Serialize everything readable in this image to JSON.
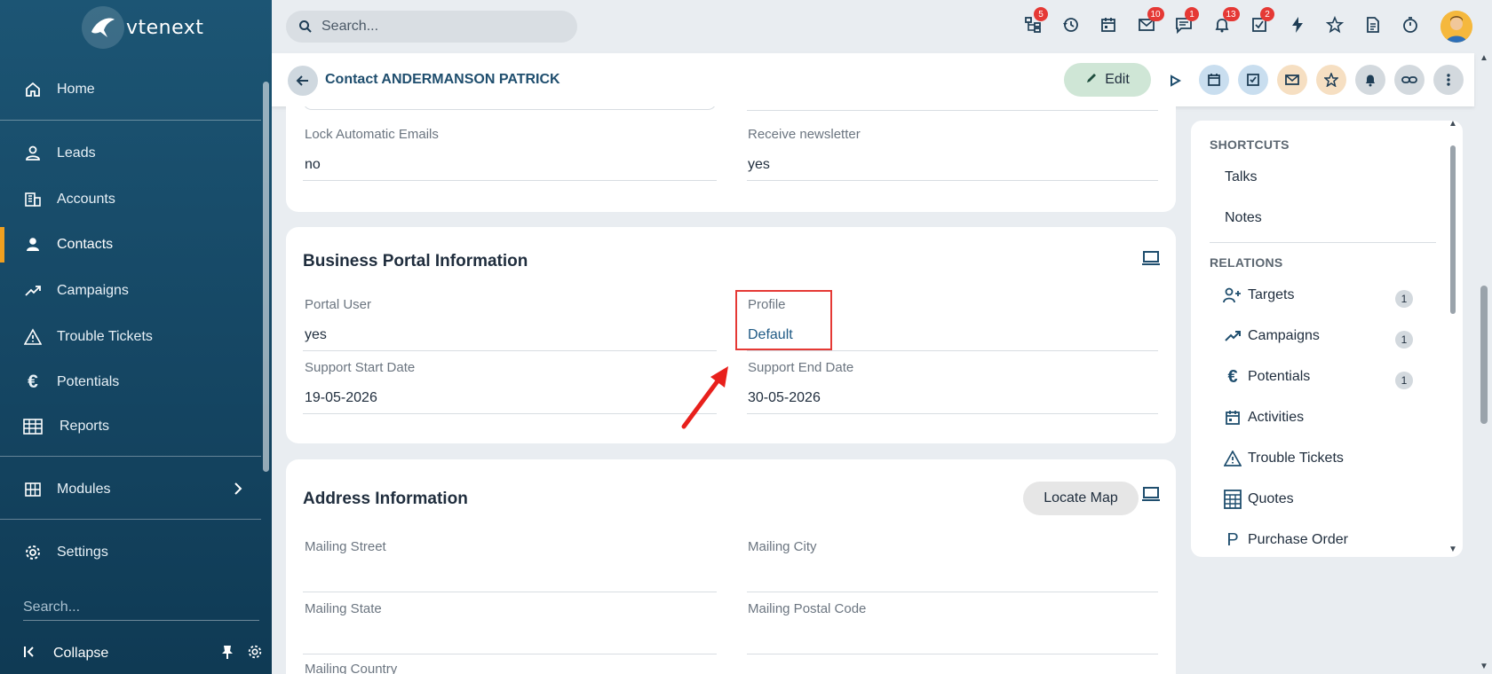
{
  "app": {
    "logo_text": "vtenext"
  },
  "sidebar": {
    "items": [
      {
        "label": "Home",
        "icon": "home-icon"
      },
      {
        "label": "Leads",
        "icon": "person-outline-icon"
      },
      {
        "label": "Accounts",
        "icon": "building-icon"
      },
      {
        "label": "Contacts",
        "icon": "person-icon"
      },
      {
        "label": "Campaigns",
        "icon": "trending-up-icon"
      },
      {
        "label": "Trouble Tickets",
        "icon": "warning-icon"
      },
      {
        "label": "Potentials",
        "icon": "euro-icon"
      },
      {
        "label": "Reports",
        "icon": "table-icon"
      },
      {
        "label": "Modules",
        "icon": "grid-icon"
      },
      {
        "label": "Settings",
        "icon": "gear-icon"
      }
    ],
    "active": "Contacts",
    "search_placeholder": "Search...",
    "collapse_label": "Collapse"
  },
  "topbar": {
    "search_placeholder": "Search...",
    "icons": [
      {
        "name": "hierarchy-icon",
        "badge": "5"
      },
      {
        "name": "history-icon",
        "badge": ""
      },
      {
        "name": "calendar-icon",
        "badge": ""
      },
      {
        "name": "mail-icon",
        "badge": "10"
      },
      {
        "name": "chat-icon",
        "badge": "1"
      },
      {
        "name": "bell-icon",
        "badge": "13"
      },
      {
        "name": "task-check-icon",
        "badge": "2"
      },
      {
        "name": "lightning-icon",
        "badge": ""
      },
      {
        "name": "star-icon",
        "badge": ""
      },
      {
        "name": "document-icon",
        "badge": ""
      },
      {
        "name": "timer-icon",
        "badge": ""
      }
    ]
  },
  "header": {
    "title": "Contact ANDERMANSON PATRICK",
    "edit_label": "Edit"
  },
  "section_top": {
    "lock_label": "Lock Automatic Emails",
    "lock_value": "no",
    "newsletter_label": "Receive newsletter",
    "newsletter_value": "yes"
  },
  "business_portal": {
    "title": "Business Portal Information",
    "portal_user_label": "Portal User",
    "portal_user_value": "yes",
    "profile_label": "Profile",
    "profile_value": "Default",
    "support_start_label": "Support Start Date",
    "support_start_value": "19-05-2026",
    "support_end_label": "Support End Date",
    "support_end_value": "30-05-2026"
  },
  "address": {
    "title": "Address Information",
    "locate_label": "Locate Map",
    "mailing_street_label": "Mailing Street",
    "mailing_city_label": "Mailing City",
    "mailing_state_label": "Mailing State",
    "mailing_postal_label": "Mailing Postal Code",
    "mailing_country_label": "Mailing Country"
  },
  "right_panel": {
    "shortcuts_heading": "SHORTCUTS",
    "shortcuts": [
      "Talks",
      "Notes"
    ],
    "relations_heading": "RELATIONS",
    "relations": [
      {
        "label": "Targets",
        "count": "1",
        "icon": "user-plus-icon"
      },
      {
        "label": "Campaigns",
        "count": "1",
        "icon": "trending-up-icon"
      },
      {
        "label": "Potentials",
        "count": "1",
        "icon": "euro-icon"
      },
      {
        "label": "Activities",
        "count": "",
        "icon": "calendar-icon"
      },
      {
        "label": "Trouble Tickets",
        "count": "",
        "icon": "warning-icon"
      },
      {
        "label": "Quotes",
        "count": "",
        "icon": "calculator-icon"
      },
      {
        "label": "Purchase Order",
        "count": "",
        "icon": "letter-p-icon"
      }
    ]
  },
  "colors": {
    "accent": "#f0a020",
    "sidebar": "#154663",
    "highlight": "#e53935"
  }
}
